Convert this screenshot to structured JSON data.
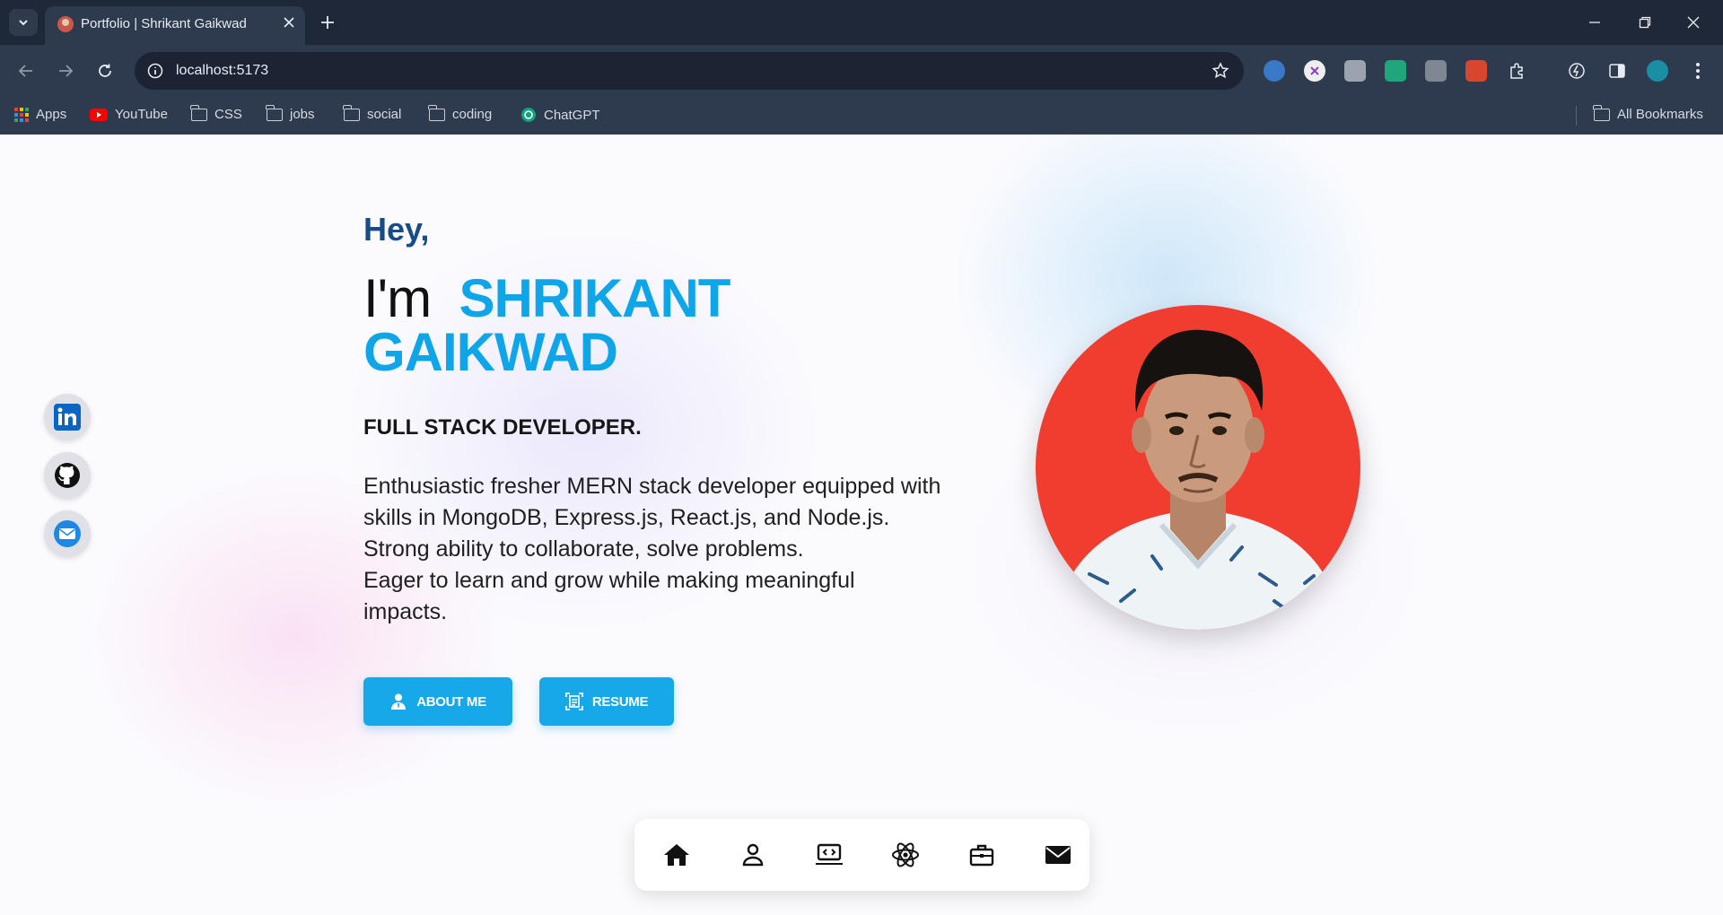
{
  "browser": {
    "tab_title": "Portfolio | Shrikant Gaikwad",
    "url": "localhost:5173",
    "bookmarks": [
      {
        "label": "Apps"
      },
      {
        "label": "YouTube"
      },
      {
        "label": "CSS"
      },
      {
        "label": "jobs"
      },
      {
        "label": "social"
      },
      {
        "label": "coding"
      },
      {
        "label": "ChatGPT"
      }
    ],
    "all_bookmarks": "All Bookmarks"
  },
  "hero": {
    "greeting": "Hey,",
    "intro": "I'm",
    "name_line1": "SHRIKANT",
    "name_line2": "GAIKWAD",
    "role": "FULL STACK DEVELOPER.",
    "bio_lines": [
      "Enthusiastic fresher MERN stack developer equipped with",
      "skills in MongoDB, Express.js, React.js, and Node.js.",
      "Strong ability to collaborate, solve problems.",
      "Eager to learn and grow while making meaningful",
      "impacts."
    ],
    "about_button": "ABOUT ME",
    "resume_button": "RESUME"
  },
  "social_links": [
    "linkedin-icon",
    "github-icon",
    "mail-icon"
  ],
  "dock_items": [
    "home-icon",
    "user-icon",
    "laptop-code-icon",
    "react-icon",
    "briefcase-icon",
    "envelope-icon"
  ],
  "colors": {
    "accent": "#0ea5e9",
    "greeting": "#174d86",
    "button": "#16a8e8",
    "avatar_bg": "#f13c30",
    "browser_bg": "#2e3a4e"
  }
}
